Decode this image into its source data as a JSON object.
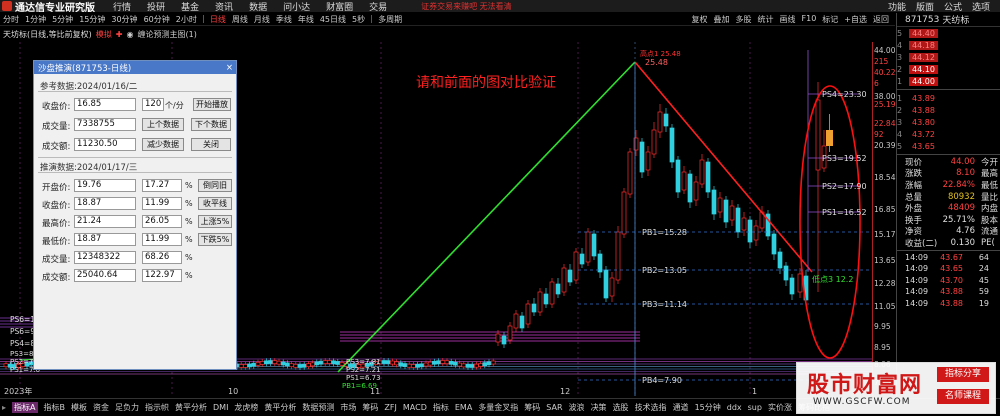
{
  "window": {
    "app_title": "通达信专业研究版",
    "menu": [
      "行情",
      "投研",
      "基金",
      "资讯",
      "数据",
      "问小达",
      "财富圈",
      "交易"
    ],
    "notice": "证券交易来赚吧 无法看清",
    "right_menu": [
      "功能",
      "版面",
      "公式",
      "选项"
    ]
  },
  "periods": {
    "items": [
      "分时",
      "1分钟",
      "5分钟",
      "15分钟",
      "30分钟",
      "60分钟",
      "2小时",
      "日线",
      "周线",
      "月线",
      "季线",
      "年线",
      "45日线",
      "5秒",
      "多周期"
    ],
    "active": "日线",
    "right_tools": [
      "复权",
      "叠加",
      "多股",
      "统计",
      "画线",
      "F10",
      "标记",
      "+自选",
      "返回"
    ]
  },
  "indicator": {
    "name": "天坊标(日线,等比前复权)",
    "mode": "模拟",
    "extra": "缠论预测主图(1)"
  },
  "annotation": "请和前面的图对比验证",
  "dialog": {
    "title": "沙盘推演(871753-日线)",
    "close": "×",
    "ref_section": "参考数据:2024/01/16/二",
    "ref": {
      "close_label": "收盘价:",
      "close_value": "16.85",
      "vol_label": "成交量:",
      "vol_value": "7338755",
      "amt_label": "成交额:",
      "amt_value": "11230.50"
    },
    "speed_value": "120",
    "speed_unit": "个/分",
    "buttons": {
      "play": "开始播放",
      "prev": "上个数据",
      "next": "下个数据",
      "minus": "减少数据",
      "close": "关闭",
      "prev_close": "倒同旧",
      "close_flat": "收平线",
      "up5": "上涨5%",
      "down5": "下跌5%"
    },
    "sim_section": "推演数据:2024/01/17/三",
    "sim": [
      {
        "label": "开盘价:",
        "value": "19.76",
        "pct": "17.27"
      },
      {
        "label": "收盘价:",
        "value": "18.87",
        "pct": "11.99"
      },
      {
        "label": "最高价:",
        "value": "21.24",
        "pct": "26.05"
      },
      {
        "label": "最低价:",
        "value": "18.87",
        "pct": "11.99"
      },
      {
        "label": "成交量:",
        "value": "12348322",
        "pct": "68.26"
      },
      {
        "label": "成交额:",
        "value": "25040.64",
        "pct": "122.97"
      }
    ],
    "pct_sign": "%"
  },
  "chart_labels": {
    "peak": "25.48",
    "peak_tag": "高点1 25.48",
    "pb1": "PB1=15.28",
    "pb2": "PB2=13.05",
    "pb3": "PB3=11.14",
    "pb4": "PB4=7.90",
    "ps4": "PS4=23.30",
    "ps3": "PS3=19.52",
    "ps2": "PS2=17.90",
    "ps1": "PS1=16.52",
    "low_tag": "低点3 12.2",
    "ps6l": "PS6=10.37",
    "ps5l": "PS6=9.56",
    "ps4l": "PS4=8.76",
    "ps3l": "PS3=8.17",
    "ps2l": "PS2=7.67",
    "ps1l": "PS1=7.0",
    "mid_ps3": "PS3=7.81",
    "mid_ps2": "PS2=7.21",
    "mid_ps1": "PS1=6.73",
    "mid_pb": "PB1=6.69",
    "x_labels": [
      "2023年",
      "10",
      "11",
      "12",
      "1"
    ]
  },
  "axis": {
    "ticks": [
      "44.00",
      "215",
      "40.22",
      "6",
      "38.00",
      "25.19",
      "22.84%",
      "92",
      "20.39",
      "18.54",
      "16.85",
      "15.17",
      "13.65",
      "12.28",
      "11.05",
      "9.95",
      "8.95",
      "8.06",
      "7.25"
    ]
  },
  "quote": {
    "code": "871753",
    "name": "天纺标",
    "asks": [
      {
        "label": "5",
        "price": "44.40"
      },
      {
        "label": "4",
        "price": "44.18"
      },
      {
        "label": "3",
        "price": "44.12"
      },
      {
        "label": "2",
        "price": "44.10"
      },
      {
        "label": "1",
        "price": "44.00"
      }
    ],
    "bids": [
      {
        "label": "1",
        "price": "43.89"
      },
      {
        "label": "2",
        "price": "43.88"
      },
      {
        "label": "3",
        "price": "43.80"
      },
      {
        "label": "4",
        "price": "43.72"
      },
      {
        "label": "5",
        "price": "43.65"
      }
    ],
    "stats": [
      {
        "k": "现价",
        "v": "44.00",
        "k2": "今开",
        "c": "red"
      },
      {
        "k": "涨跌",
        "v": "8.10",
        "k2": "最高",
        "c": "red"
      },
      {
        "k": "涨幅",
        "v": "22.84%",
        "k2": "最低",
        "c": "red"
      },
      {
        "k": "总量",
        "v": "80932",
        "k2": "量比",
        "c": "yel"
      },
      {
        "k": "外盘",
        "v": "48409",
        "k2": "内盘",
        "c": "red"
      },
      {
        "k": "换手",
        "v": "25.71%",
        "k2": "股本",
        "c": "wht"
      },
      {
        "k": "净资",
        "v": "4.76",
        "k2": "流通",
        "c": "wht"
      },
      {
        "k": "收益(二)",
        "v": "0.130",
        "k2": "PE(",
        "c": "wht"
      }
    ],
    "ticks": [
      {
        "t": "14:09",
        "p": "43.67",
        "v": "64"
      },
      {
        "t": "14:09",
        "p": "43.65",
        "v": "24"
      },
      {
        "t": "14:09",
        "p": "43.70",
        "v": "45"
      },
      {
        "t": "14:09",
        "p": "43.88",
        "v": "59"
      },
      {
        "t": "14:09",
        "p": "43.88",
        "v": "19"
      }
    ]
  },
  "bottom_tabs": {
    "prefix": "▸",
    "items": [
      "指标A",
      "指标B",
      "模板",
      "资金",
      "足负力",
      "指示帜",
      "黄平分析",
      "DMI",
      "龙虎榜",
      "黄平分析",
      "数据预测",
      "市场",
      "筹码",
      "ZFJ",
      "MACD",
      "指标",
      "EMA",
      "多量金叉指",
      "筹码",
      "SAR",
      "波浪",
      "决策",
      "选股",
      "技术选指",
      "通道",
      "15分钟",
      "ddx",
      "sup",
      "实价涨",
      "筹码比指"
    ],
    "active": "指标A"
  },
  "watermark": {
    "big": "股市财富网",
    "small": "WWW.GSCFW.COM",
    "tag1": "指标分享",
    "tag2": "名师课程"
  }
}
